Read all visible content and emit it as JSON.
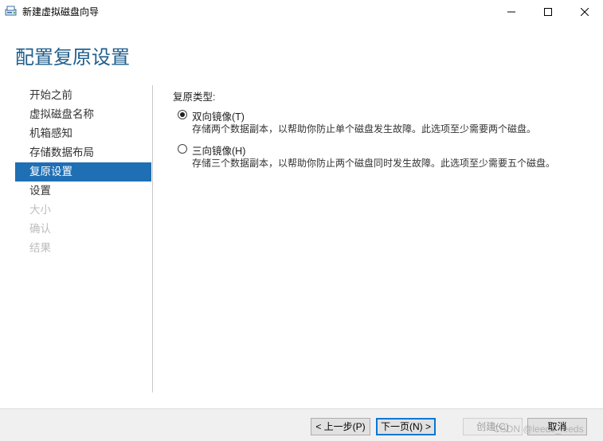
{
  "window": {
    "title": "新建虚拟磁盘向导",
    "icon": "disk-wizard-icon",
    "controls": [
      "minimize-icon",
      "maximize-icon",
      "close-icon"
    ]
  },
  "page_title": "配置复原设置",
  "nav": {
    "items": [
      {
        "label": "开始之前",
        "state": "normal"
      },
      {
        "label": "虚拟磁盘名称",
        "state": "normal"
      },
      {
        "label": "机箱感知",
        "state": "normal"
      },
      {
        "label": "存储数据布局",
        "state": "normal"
      },
      {
        "label": "复原设置",
        "state": "active"
      },
      {
        "label": "设置",
        "state": "normal"
      },
      {
        "label": "大小",
        "state": "disabled"
      },
      {
        "label": "确认",
        "state": "disabled"
      },
      {
        "label": "结果",
        "state": "disabled"
      }
    ]
  },
  "content": {
    "section_label": "复原类型:",
    "options": [
      {
        "label": "双向镜像(T)",
        "description": "存储两个数据副本，以帮助你防止单个磁盘发生故障。此选项至少需要两个磁盘。",
        "checked": true
      },
      {
        "label": "三向镜像(H)",
        "description": "存储三个数据副本，以帮助你防止两个磁盘同时发生故障。此选项至少需要五个磁盘。",
        "checked": false
      }
    ]
  },
  "footer": {
    "prev_label": "< 上一步(P)",
    "next_label": "下一页(N) >",
    "create_label": "创建(C)",
    "cancel_label": "取消"
  },
  "watermark": "CSDN @leeds_leeds",
  "colors": {
    "accent": "#1e6fb4",
    "title_blue": "#1f5e8c",
    "disabled_text": "#bdbdbd",
    "footer_bg": "#f0f0f0"
  }
}
